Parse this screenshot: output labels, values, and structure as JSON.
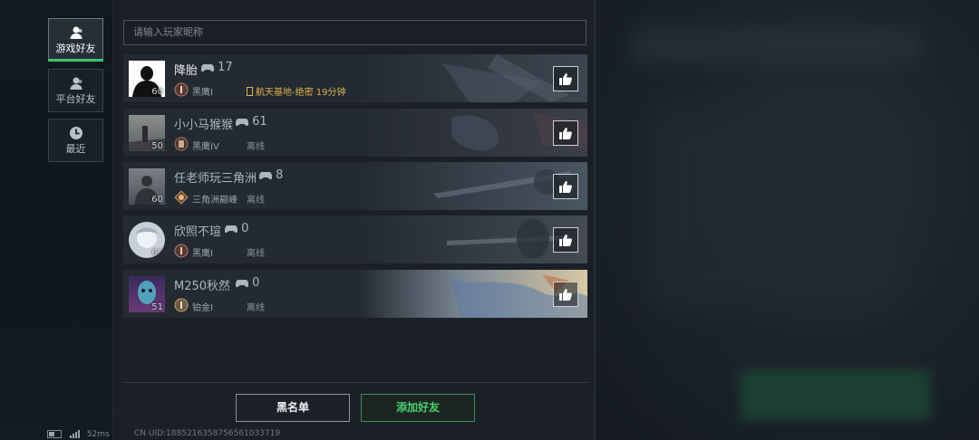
{
  "sidebar": {
    "tabs": [
      {
        "label": "游戏好友",
        "icon": "user-icon",
        "active": true
      },
      {
        "label": "平台好友",
        "icon": "user-icon",
        "active": false
      },
      {
        "label": "最近",
        "icon": "clock-icon",
        "active": false
      }
    ]
  },
  "status_bar": {
    "ping": "52ms"
  },
  "search": {
    "placeholder": "请输入玩家昵称"
  },
  "friends": [
    {
      "name": "降胎",
      "count": "17",
      "level": "60",
      "rank": "黑鹰I",
      "status": "航天基地-绝密 19分钟",
      "online": true
    },
    {
      "name": "小小马猴猴",
      "count": "61",
      "level": "50",
      "rank": "黑鹰IV",
      "status": "离线",
      "online": false
    },
    {
      "name": "任老师玩三角洲",
      "count": "8",
      "level": "60",
      "rank": "三角洲巅峰",
      "status": "离线",
      "online": false
    },
    {
      "name": "欣照不瑄",
      "count": "0",
      "level": "60",
      "rank": "黑鹰I",
      "status": "离线",
      "online": false
    },
    {
      "name": "M250秋然",
      "count": "0",
      "level": "51",
      "rank": "铂金I",
      "status": "离线",
      "online": false
    }
  ],
  "footer": {
    "blacklist_label": "黑名单",
    "add_friend_label": "添加好友",
    "uid": "CN UID:1885216358756561033719"
  },
  "colors": {
    "accent_green": "#3ec46d",
    "online_status": "#e1b44b"
  }
}
